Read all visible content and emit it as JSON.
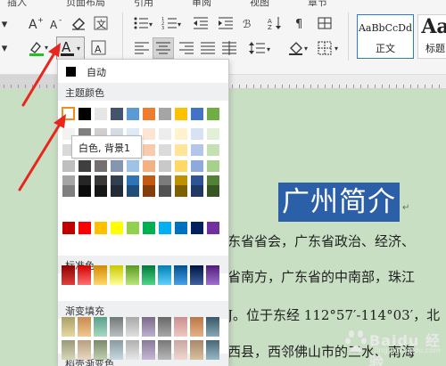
{
  "menu": {
    "items": [
      "插入",
      "页面布局",
      "引用",
      "审阅",
      "视图",
      "章节"
    ]
  },
  "styles": [
    {
      "preview": "AaBbCcDd",
      "name": "正文",
      "selected": true
    },
    {
      "preview": "Aa",
      "name": "标题"
    }
  ],
  "palette": {
    "auto_label": "自动",
    "theme_title": "主题颜色",
    "standard_title": "标准色",
    "gradient_title": "渐变填充",
    "shell_title": "稻壳渐变色",
    "tooltip": "白色, 背景1",
    "theme_top": [
      "#ffffff",
      "#000000",
      "#e7e6e6",
      "#44546a",
      "#5b9bd5",
      "#ed7d31",
      "#a5a5a5",
      "#ffc000",
      "#4472c4",
      "#70ad47"
    ],
    "theme_shades": [
      [
        "#f2f2f2",
        "#7f7f7f",
        "#d0cece",
        "#d6dce4",
        "#deebf6",
        "#fbe5d5",
        "#ededed",
        "#fff2cc",
        "#d9e2f3",
        "#e2efd9"
      ],
      [
        "#d9d9d9",
        "#595959",
        "#aeabab",
        "#adb9ca",
        "#bdd7ee",
        "#f7cbac",
        "#dbdbdb",
        "#fee599",
        "#b4c6e7",
        "#c5e0b3"
      ],
      [
        "#bfbfbf",
        "#3f3f3f",
        "#757070",
        "#8496b0",
        "#9dc3e6",
        "#f4b183",
        "#c9c9c9",
        "#ffd965",
        "#8eaadb",
        "#a8d08d"
      ],
      [
        "#a5a5a5",
        "#262626",
        "#3a3838",
        "#323f4f",
        "#2e75b5",
        "#c45911",
        "#7b7b7b",
        "#bf9000",
        "#2f5496",
        "#538135"
      ],
      [
        "#7f7f7f",
        "#0c0c0c",
        "#171616",
        "#222a35",
        "#1e4e79",
        "#833c0b",
        "#525252",
        "#7f6000",
        "#1f3864",
        "#375623"
      ]
    ],
    "standard": [
      "#c00000",
      "#ff0000",
      "#ffc000",
      "#ffff00",
      "#92d050",
      "#00b050",
      "#00b0f0",
      "#0070c0",
      "#002060",
      "#7030a0"
    ],
    "gradient": [
      [
        "#8b0000",
        "#e04040"
      ],
      [
        "#d00000",
        "#ff7070"
      ],
      [
        "#d08a00",
        "#ffd86b"
      ],
      [
        "#c8c800",
        "#ffff9a"
      ],
      [
        "#5a9a20",
        "#b9e57d"
      ],
      [
        "#007a38",
        "#50d48a"
      ],
      [
        "#0080b0",
        "#60d0ff"
      ],
      [
        "#004f90",
        "#4aa0e8"
      ],
      [
        "#001440",
        "#4060a0"
      ],
      [
        "#4f1c78",
        "#a070d0"
      ]
    ],
    "shell_rows": [
      [
        [
          "#a8a068",
          "#e8d8a0"
        ],
        [
          "#c88a50",
          "#f0c890"
        ],
        [
          "#5aa08a",
          "#a8d8c0"
        ],
        [
          "#707878",
          "#b8c0c0"
        ],
        [
          "#a8a8a8",
          "#e0e0e0"
        ],
        [
          "#7a6a88",
          "#c0b0d0"
        ],
        [
          "#686868",
          "#a8a8a8"
        ],
        [
          "#c89090",
          "#f0c8c0"
        ],
        [
          "#b87848",
          "#e8b088"
        ],
        [
          "#385868",
          "#88a8b8"
        ]
      ],
      [
        [
          "#9a9a7a",
          "#d8d8b8"
        ],
        [
          "#b8a080",
          "#e8d8c0"
        ],
        [
          "#7a8a6a",
          "#c0d0b0"
        ],
        [
          "#8a9aa0",
          "#c8d8e0"
        ],
        [
          "#b0b0b0",
          "#e8e8e8"
        ],
        [
          "#8a7a9a",
          "#c8b8d8"
        ],
        [
          "#787878",
          "#b8b8b8"
        ],
        [
          "#c8a8a0",
          "#f0d8d0"
        ],
        [
          "#a88868",
          "#d8c0a0"
        ],
        [
          "#486878",
          "#98b8c8"
        ]
      ]
    ]
  },
  "document": {
    "title": "广州简介",
    "lines": [
      "东省省会，广东省政治、经济、",
      "省南方，广东省的中南部，珠江",
      "J。位于东经 112°57′-114°03′，北",
      "西县，西邻佛山市的三水、南海"
    ]
  },
  "watermark": {
    "text": "Baidu 经验",
    "sub": "jingyan.baidu.com"
  }
}
